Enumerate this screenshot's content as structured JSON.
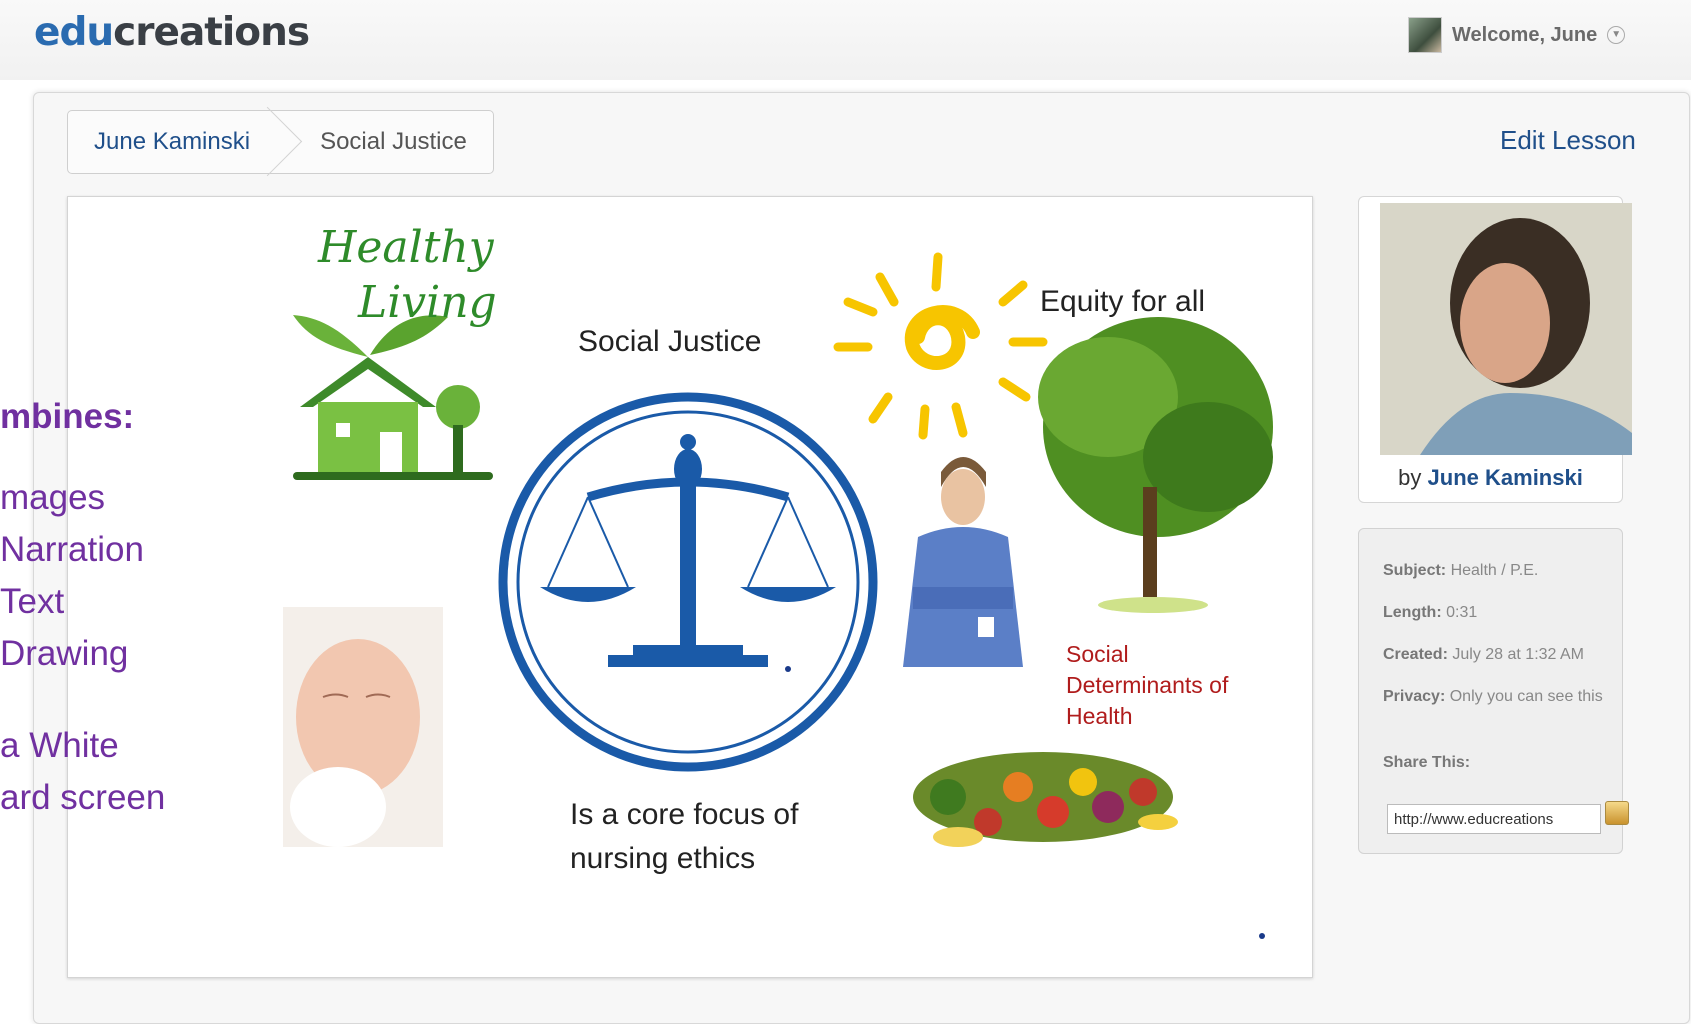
{
  "header": {
    "logo_edu": "edu",
    "logo_rest": "creations",
    "welcome": "Welcome, June",
    "caret_icon": "chevron-down-icon"
  },
  "breadcrumb": {
    "items": [
      {
        "label": "June Kaminski"
      },
      {
        "label": "Social Justice"
      }
    ]
  },
  "actions": {
    "edit_lesson": "Edit Lesson"
  },
  "side_slide": {
    "heading": "mbines:",
    "items": [
      "mages",
      "Narration",
      "Text",
      "Drawing"
    ],
    "tail1": "a White",
    "tail2": "ard screen"
  },
  "board": {
    "healthy": "Healthy",
    "living": "Living",
    "social_justice": "Social Justice",
    "equity": "Equity for all",
    "determinants_line1": "Social",
    "determinants_line2": "Determinants of",
    "determinants_line3": "Health",
    "core_line1": "Is a core focus of",
    "core_line2": "nursing ethics"
  },
  "author": {
    "by": "by",
    "name": "June Kaminski"
  },
  "info": {
    "subject_label": "Subject:",
    "subject_value": "Health / P.E.",
    "length_label": "Length:",
    "length_value": "0:31",
    "created_label": "Created:",
    "created_value": "July 28 at 1:32 AM",
    "privacy_label": "Privacy:",
    "privacy_value": "Only you can see this",
    "share_label": "Share This:",
    "share_url": "http://www.educreations"
  },
  "colors": {
    "brand_blue": "#2a6bb0",
    "link_blue": "#1f4f8a",
    "slide_purple": "#7030a0",
    "scales_blue": "#1a5aa8",
    "determinants_red": "#b01c1c"
  }
}
